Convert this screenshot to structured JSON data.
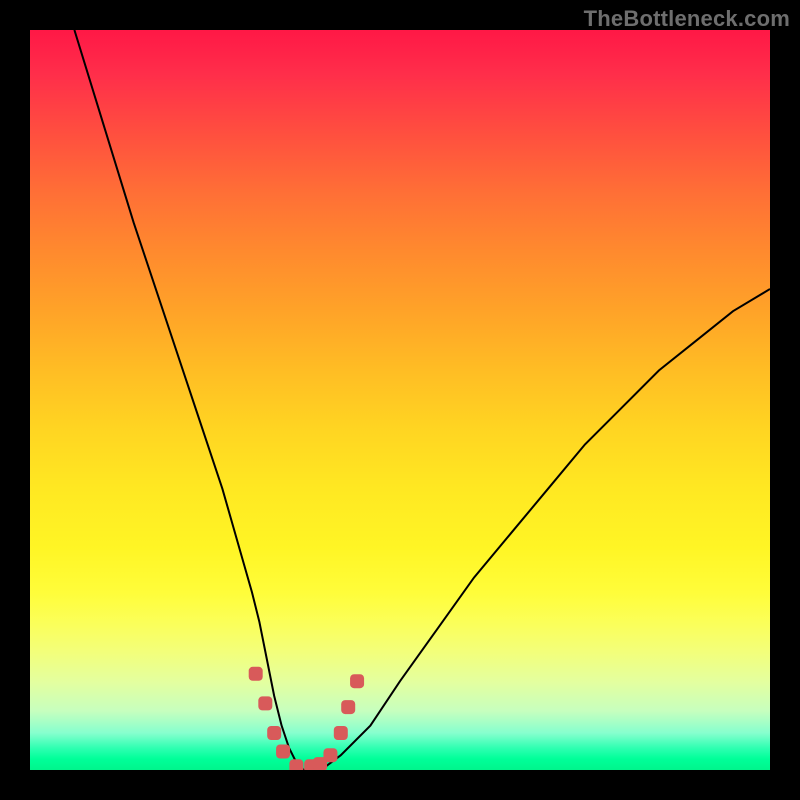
{
  "watermark": "TheBottleneck.com",
  "chart_data": {
    "type": "line",
    "title": "",
    "xlabel": "",
    "ylabel": "",
    "xlim": [
      0,
      100
    ],
    "ylim": [
      0,
      100
    ],
    "grid": false,
    "legend": false,
    "series": [
      {
        "name": "bottleneck-curve",
        "x": [
          6,
          10,
          14,
          18,
          22,
          26,
          28,
          30,
          31,
          32,
          33,
          34,
          35,
          36,
          37,
          38,
          39,
          40,
          42,
          46,
          50,
          55,
          60,
          65,
          70,
          75,
          80,
          85,
          90,
          95,
          100
        ],
        "y": [
          100,
          87,
          74,
          62,
          50,
          38,
          31,
          24,
          20,
          15,
          10,
          6,
          3,
          1,
          0,
          0,
          0,
          0.5,
          2,
          6,
          12,
          19,
          26,
          32,
          38,
          44,
          49,
          54,
          58,
          62,
          65
        ]
      }
    ],
    "markers": {
      "name": "highlight-points",
      "x": [
        30.5,
        31.8,
        33,
        34.2,
        36,
        38,
        39.2,
        40.6,
        42,
        43,
        44.2
      ],
      "y": [
        13,
        9,
        5,
        2.5,
        0.5,
        0.5,
        0.8,
        2,
        5,
        8.5,
        12
      ]
    },
    "background": {
      "type": "vertical-gradient",
      "stops": [
        {
          "pos": 0.0,
          "color": "#ff1846"
        },
        {
          "pos": 0.5,
          "color": "#ffd522"
        },
        {
          "pos": 0.8,
          "color": "#fbff58"
        },
        {
          "pos": 0.97,
          "color": "#30ffb2"
        },
        {
          "pos": 1.0,
          "color": "#00f58c"
        }
      ]
    }
  },
  "colors": {
    "curve": "#000000",
    "marker": "#d85a5a",
    "frame": "#000000"
  }
}
